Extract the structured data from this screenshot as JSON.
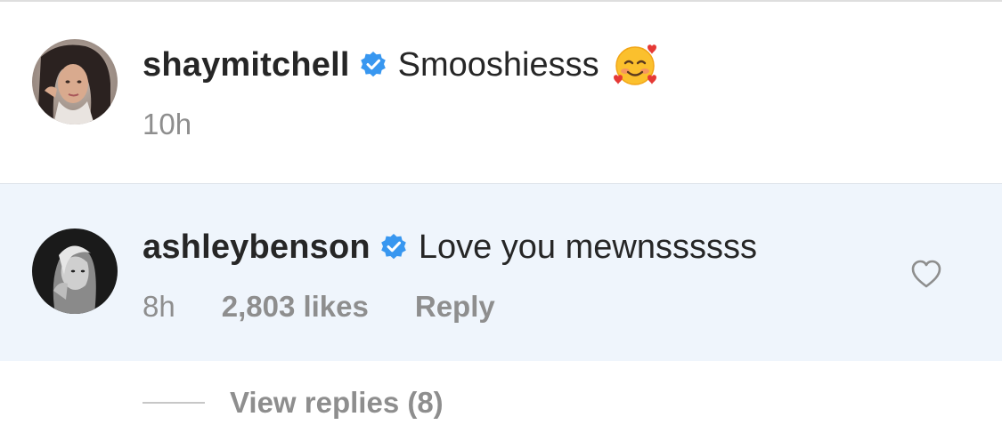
{
  "comments": [
    {
      "username": "shaymitchell",
      "verified": true,
      "text": "Smooshiesss",
      "emoji": "smiling-face-with-hearts",
      "time": "10h"
    },
    {
      "username": "ashleybenson",
      "verified": true,
      "text": "Love you mewnssssss",
      "time": "8h",
      "likes": "2,803 likes",
      "reply_label": "Reply",
      "highlighted": true
    }
  ],
  "view_replies": "View replies (8)",
  "colors": {
    "text_primary": "#262626",
    "text_secondary": "#8e8e8e",
    "verified_blue": "#3897f0",
    "highlight_bg": "#eff5fc"
  }
}
